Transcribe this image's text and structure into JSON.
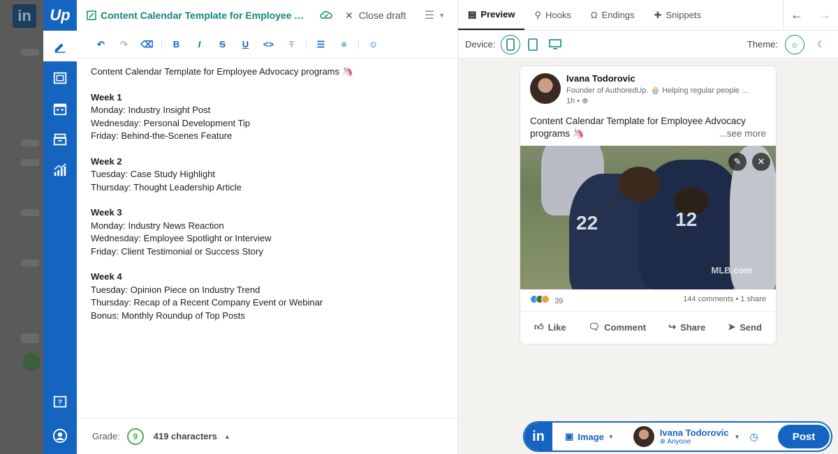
{
  "background": {
    "logo_text": "in"
  },
  "sidenav": {
    "logo_text": "Up"
  },
  "editor": {
    "title": "Content Calendar Template for Employee Adv...",
    "close_draft": "Close draft",
    "toolbar": {
      "buttons": [
        "undo-icon",
        "redo-icon",
        "eraser-icon",
        "bold-icon",
        "italic-icon",
        "strikethrough-icon",
        "underline-icon",
        "code-icon",
        "clear-format-icon",
        "bullet-list-icon",
        "numbered-list-icon",
        "emoji-icon"
      ]
    },
    "lines": [
      "Content Calendar Template for Employee Advocacy programs 🦄",
      "",
      "Week 1",
      "Monday: Industry Insight Post",
      "Wednesday: Personal Development Tip",
      "Friday: Behind-the-Scenes Feature",
      "",
      "Week 2",
      "Tuesday: Case Study Highlight",
      "Thursday: Thought Leadership Article",
      "",
      "Week 3",
      "Monday: Industry News Reaction",
      "Wednesday: Employee Spotlight or Interview",
      "Friday: Client Testimonial or Success Story",
      "",
      "Week 4",
      "Tuesday: Opinion Piece on Industry Trend",
      "Thursday: Recap of a Recent Company Event or Webinar",
      "Bonus: Monthly Roundup of Top Posts"
    ],
    "footer": {
      "grade_label": "Grade:",
      "grade_value": "9",
      "characters": "419 characters"
    }
  },
  "preview": {
    "tabs": [
      {
        "label": "Preview",
        "icon": "preview-icon",
        "active": true
      },
      {
        "label": "Hooks",
        "icon": "hook-icon",
        "active": false
      },
      {
        "label": "Endings",
        "icon": "omega-icon",
        "active": false
      },
      {
        "label": "Snippets",
        "icon": "puzzle-icon",
        "active": false
      }
    ],
    "device_label": "Device:",
    "theme_label": "Theme:",
    "post": {
      "author": "Ivana Todorovic",
      "headline": "Founder of AuthoredUp. 🧁 Helping regular people ...",
      "time": "1h •",
      "text_line1": "Content Calendar Template for Employee Advocacy",
      "text_line2": "programs 🦄",
      "see_more": "...see more",
      "watermark": "MLB.com",
      "reactions_count": "39",
      "comments_shares": "144 comments • 1 share",
      "actions": [
        "Like",
        "Comment",
        "Share",
        "Send"
      ]
    }
  },
  "postbar": {
    "li_text": "in",
    "image_label": "Image",
    "user_name": "Ivana Todorovic",
    "visibility": "Anyone",
    "post_label": "Post"
  },
  "colors": {
    "brand_blue": "#1565c0",
    "accent_teal": "#11887a",
    "grade_green": "#4caf50"
  }
}
